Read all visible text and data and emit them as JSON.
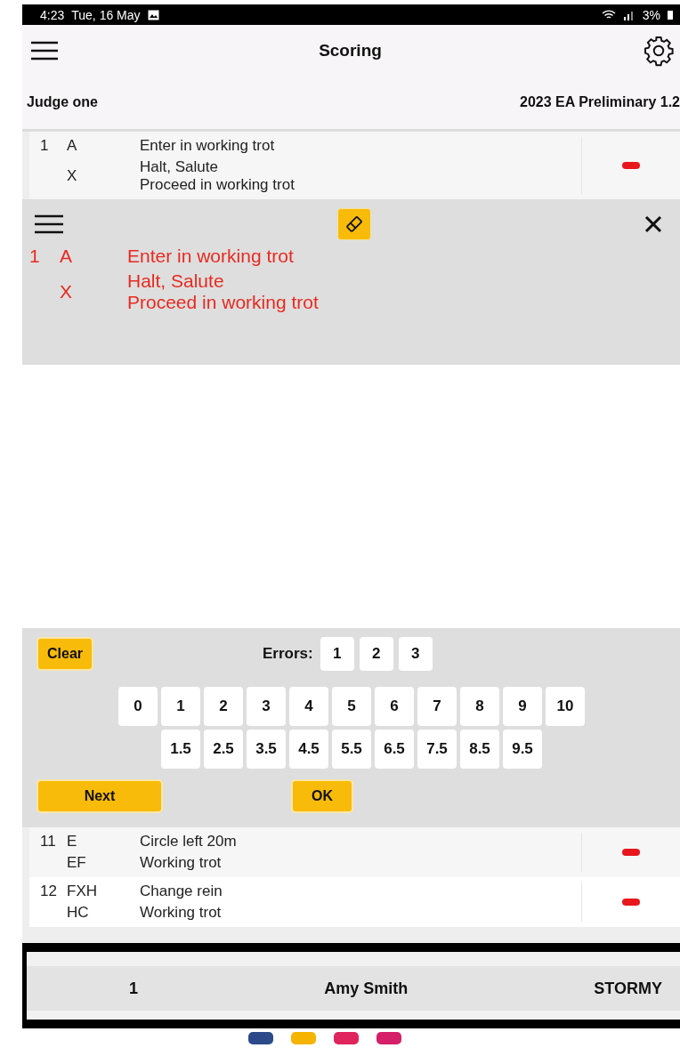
{
  "status_bar": {
    "time": "4:23",
    "date": "Tue, 16 May",
    "battery": "3%"
  },
  "header": {
    "title": "Scoring"
  },
  "info": {
    "judge": "Judge one",
    "test": "2023 EA Preliminary 1.2"
  },
  "top_rows": [
    {
      "number": "1",
      "letters": [
        "A",
        "X"
      ],
      "lines": [
        [
          "Enter in working trot"
        ],
        [
          "Halt, Salute",
          "Proceed in working trot"
        ]
      ]
    }
  ],
  "detail": {
    "number": "1",
    "letters": [
      "A",
      "X"
    ],
    "lines": [
      [
        "Enter in working trot"
      ],
      [
        "Halt, Salute",
        "Proceed in working trot"
      ]
    ]
  },
  "keypad": {
    "clear": "Clear",
    "errors_label": "Errors:",
    "errors": [
      "1",
      "2",
      "3"
    ],
    "scores": [
      "0",
      "1",
      "2",
      "3",
      "4",
      "5",
      "6",
      "7",
      "8",
      "9",
      "10"
    ],
    "half_scores": [
      "1.5",
      "2.5",
      "3.5",
      "4.5",
      "5.5",
      "6.5",
      "7.5",
      "8.5",
      "9.5"
    ],
    "next": "Next",
    "ok": "OK"
  },
  "bottom_rows": [
    {
      "number": "11",
      "letters": [
        "E",
        "EF"
      ],
      "lines": [
        [
          "Circle left 20m"
        ],
        [
          "Working trot"
        ]
      ]
    },
    {
      "number": "12",
      "letters": [
        "FXH",
        "HC"
      ],
      "lines": [
        [
          "Change rein"
        ],
        [
          "Working trot"
        ]
      ]
    }
  ],
  "footer": {
    "number": "1",
    "rider": "Amy Smith",
    "horse": "STORMY"
  }
}
